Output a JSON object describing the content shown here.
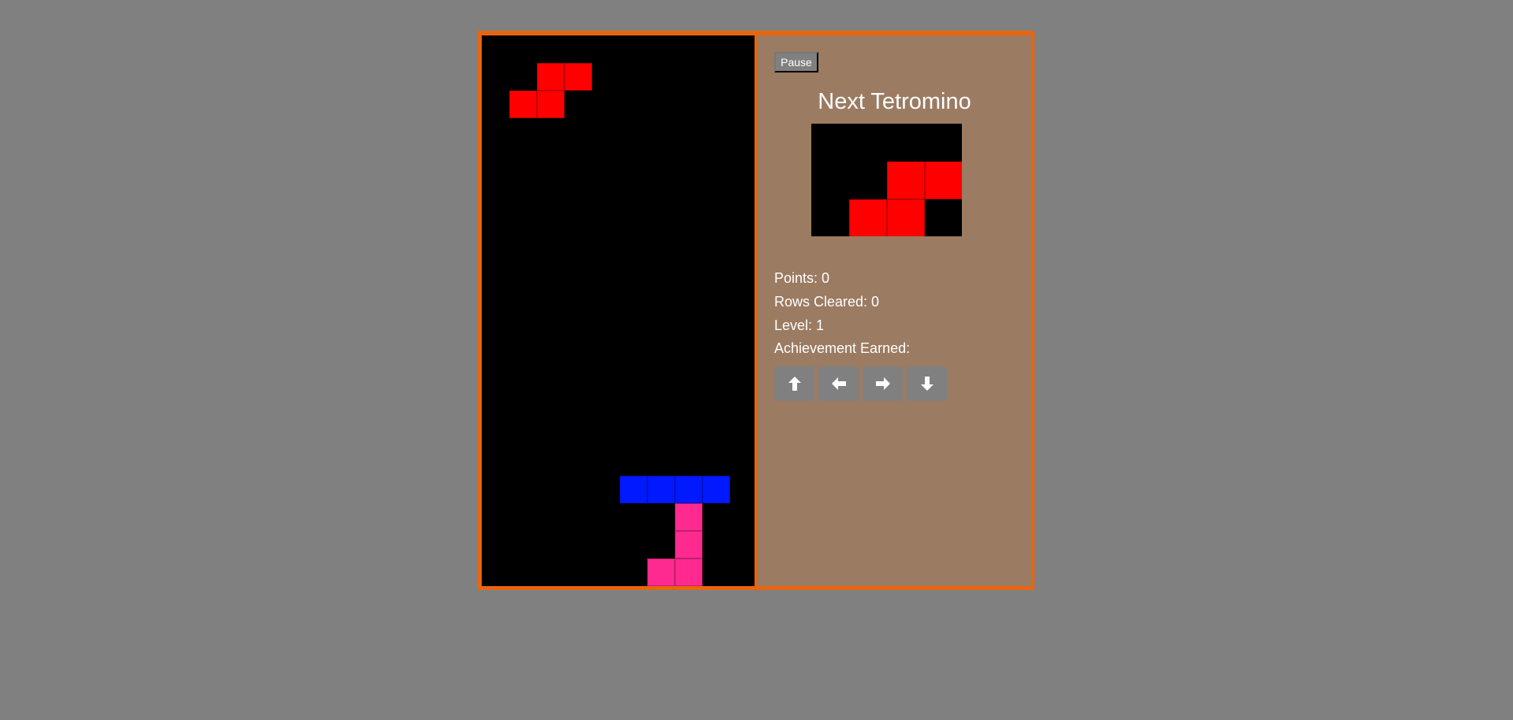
{
  "board": {
    "cell_colors": {
      "red": "#ff0000",
      "blue": "#0019ff",
      "pink": "#ff2a8f"
    },
    "background": "#000000"
  },
  "side_panel": {
    "pause_label": "Pause",
    "next_title": "Next Tetromino",
    "stats": {
      "points": "Points: 0",
      "rows_cleared": "Rows Cleared: 0",
      "level": "Level: 1",
      "achievement": "Achievement Earned:"
    },
    "controls": [
      {
        "icon": "arrow-up-icon"
      },
      {
        "icon": "arrow-left-icon"
      },
      {
        "icon": "arrow-right-icon"
      },
      {
        "icon": "arrow-down-icon"
      }
    ]
  }
}
